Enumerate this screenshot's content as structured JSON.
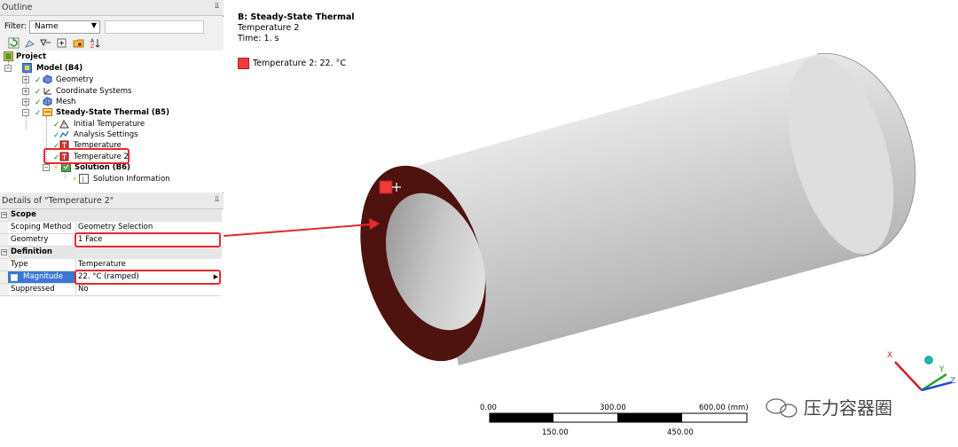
{
  "outline": {
    "title": "Outline",
    "filter_label": "Filter:",
    "filter_value": "Name",
    "tree": {
      "project": "Project",
      "model": "Model (B4)",
      "geometry": "Geometry",
      "coordinate_systems": "Coordinate Systems",
      "mesh": "Mesh",
      "steady_state": "Steady-State Thermal (B5)",
      "initial_temperature": "Initial Temperature",
      "analysis_settings": "Analysis Settings",
      "temperature": "Temperature",
      "temperature2": "Temperature 2",
      "solution": "Solution (B6)",
      "solution_information": "Solution Information"
    }
  },
  "details": {
    "title": "Details of \"Temperature 2\"",
    "scope_header": "Scope",
    "scoping_method_key": "Scoping Method",
    "scoping_method_val": "Geometry Selection",
    "geometry_key": "Geometry",
    "geometry_val": "1 Face",
    "definition_header": "Definition",
    "type_key": "Type",
    "type_val": "Temperature",
    "magnitude_key": "Magnitude",
    "magnitude_val": "22. °C  (ramped)",
    "suppressed_key": "Suppressed",
    "suppressed_val": "No"
  },
  "viewport": {
    "analysis_title": "B: Steady-State Thermal",
    "object_name": "Temperature 2",
    "time": "Time: 1. s",
    "legend_text": "Temperature 2: 22. °C",
    "legend_color": "#ee3a3a",
    "face_color": "#4e120f",
    "scale": {
      "top_labels": [
        "0.00",
        "300.00",
        "600.00 (mm)"
      ],
      "bottom_labels": [
        "150.00",
        "450.00"
      ]
    },
    "axis_labels": {
      "x": "X",
      "y": "Y",
      "z": "Z"
    },
    "watermark": "压力容器圈"
  }
}
